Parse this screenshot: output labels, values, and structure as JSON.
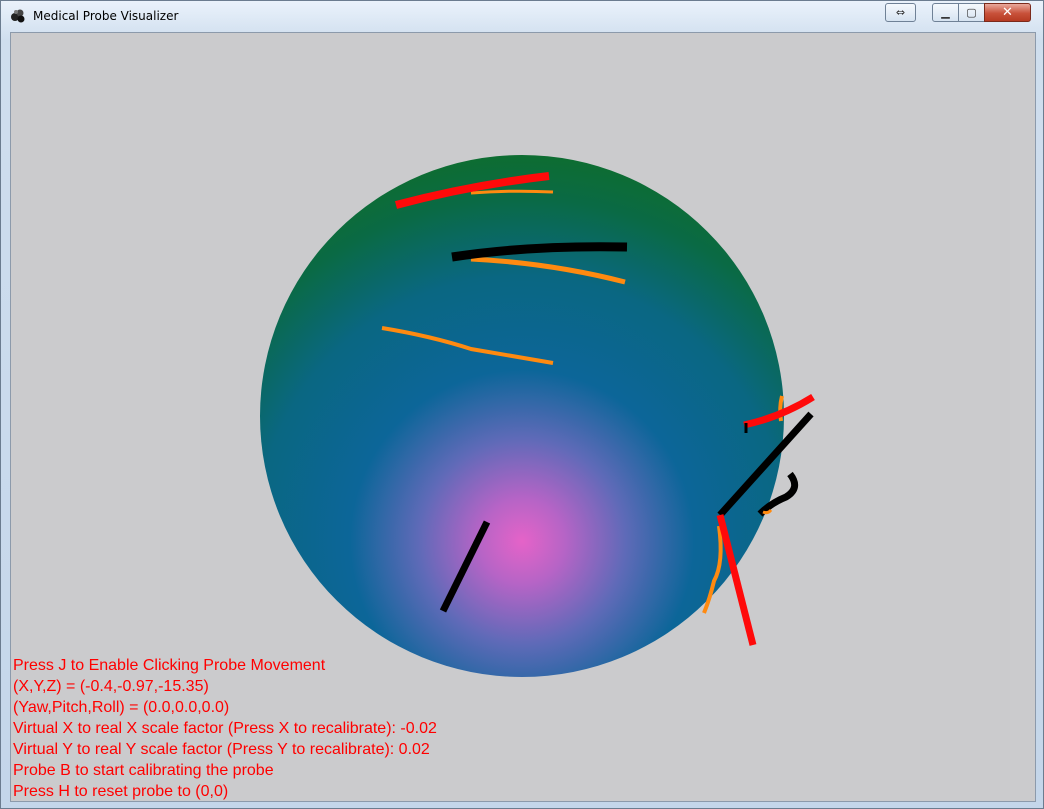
{
  "window": {
    "title": "Medical Probe Visualizer",
    "buttons": {
      "snap": "⇔",
      "minimize": "▁",
      "maximize": "▢",
      "close": "✕"
    }
  },
  "colors": {
    "background": "#cbcbcd",
    "sphere_top": "#11701e",
    "sphere_mid": "#0c6699",
    "sphere_glow": "#e563c8",
    "probe_red": "#ff0a0a",
    "probe_orange": "#ff8a10",
    "probe_black": "#000000",
    "hud_text": "#ff0000"
  },
  "hud": {
    "line1": "Press J to Enable Clicking Probe Movement",
    "line2": "(X,Y,Z) = (-0.4,-0.97,-15.35)",
    "line3": "(Yaw,Pitch,Roll) = (0.0,0.0,0.0)",
    "line4": "Virtual X to real X scale factor (Press X to recalibrate): -0.02",
    "line5": "Virtual Y to real Y scale factor (Press Y to recalibrate): 0.02",
    "line6": "Probe B to start calibrating the probe",
    "line7": "Press H to reset probe to (0,0)"
  }
}
